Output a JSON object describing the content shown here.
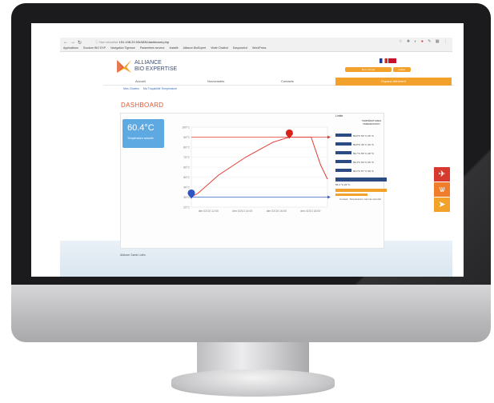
{
  "browser": {
    "back_icon": "back-arrow-icon",
    "forward_icon": "forward-arrow-icon",
    "reload_icon": "reload-icon",
    "url_prefix": "ⓘ Non sécurisé",
    "url_value": "151.108.29.93/ABS/dashboard.php",
    "bookmarks": [
      "Applications",
      "Soudure BIO EXP",
      "Navigation Tigresse",
      "Paramètres serveur",
      "Installé",
      "Alliance BioExpert",
      "Visite Chatbot",
      "Easycontrol",
      "WordPress"
    ]
  },
  "brand": {
    "line1": "ALLIANCE",
    "line2": "BIO EXPERTISE",
    "colors": {
      "orange": "#f2a12b",
      "blue": "#3a4f7a",
      "accent_red": "#e4562f"
    }
  },
  "header": {
    "flags": [
      "fr",
      "uk"
    ],
    "account_pill": "Mon compte",
    "logout_pill": "Quitter"
  },
  "tabs": [
    {
      "label": "Accueil"
    },
    {
      "label": "Nouveautés"
    },
    {
      "label": "Contacts"
    },
    {
      "label": "Espace Adhérent"
    }
  ],
  "subnav": [
    "Mes Chartes",
    "Ma Traçabilité Température"
  ],
  "page_title": "DASHBOARD",
  "kpi": {
    "value": "60.4°C",
    "label": "Température actuelle"
  },
  "chart_data": {
    "type": "line",
    "y_ticks": [
      "100°C",
      "90°C",
      "80°C",
      "70°C",
      "60°C",
      "50°C",
      "40°C",
      "30°C",
      "20°C"
    ],
    "x_ticks": [
      "dim 02/10 12:00",
      "dim 02/10 14:00",
      "dim 02/10 16:00",
      "dim 02/10 18:00"
    ],
    "ylim": [
      20,
      100
    ],
    "thresholds": [
      {
        "name": "max",
        "value": 90,
        "color": "#e23b35"
      },
      {
        "name": "min",
        "value": 30,
        "color": "#3d66c7"
      }
    ],
    "series": [
      {
        "color": "#e23b35",
        "points": [
          [
            0,
            30
          ],
          [
            0.05,
            34
          ],
          [
            0.2,
            52
          ],
          [
            0.4,
            70
          ],
          [
            0.6,
            85
          ],
          [
            0.72,
            90
          ],
          [
            0.88,
            90
          ],
          [
            0.95,
            62
          ],
          [
            1.0,
            48
          ]
        ]
      }
    ],
    "markers": [
      {
        "x": 0.0,
        "y": 30,
        "color": "#2f52c4"
      },
      {
        "x": 0.72,
        "y": 90,
        "color": "#d8231c"
      }
    ],
    "grid": true
  },
  "sidebar": {
    "top_label": "Limite",
    "head": "TEMPÉRATURES PRÉPARATION",
    "rows": [
      {
        "a": "59.9°C",
        "b": "56 °C",
        "c": "25 °C"
      },
      {
        "a": "59.8°C",
        "b": "45 °C",
        "c": "30 °C"
      },
      {
        "a": "59.7°C",
        "b": "55 °C",
        "c": "28 °C"
      },
      {
        "a": "59.4°C",
        "b": "60 °C",
        "c": "25 °C"
      },
      {
        "a": "60.1°C",
        "b": "57 °C",
        "c": "39 °C"
      }
    ],
    "foot": "56.3 °C    24 °C",
    "note": "Conseil : Température maxi de sécurité"
  },
  "side_widgets": [
    {
      "icon": "plane-icon",
      "color": "#d63a2e",
      "glyph": "✈"
    },
    {
      "icon": "grain-icon",
      "color": "#f07d2c",
      "glyph": "ѡ"
    },
    {
      "icon": "arrow-icon",
      "color": "#f2a12b",
      "glyph": "➤"
    }
  ],
  "footer": {
    "text": "Alliance Santé    Lidés"
  }
}
